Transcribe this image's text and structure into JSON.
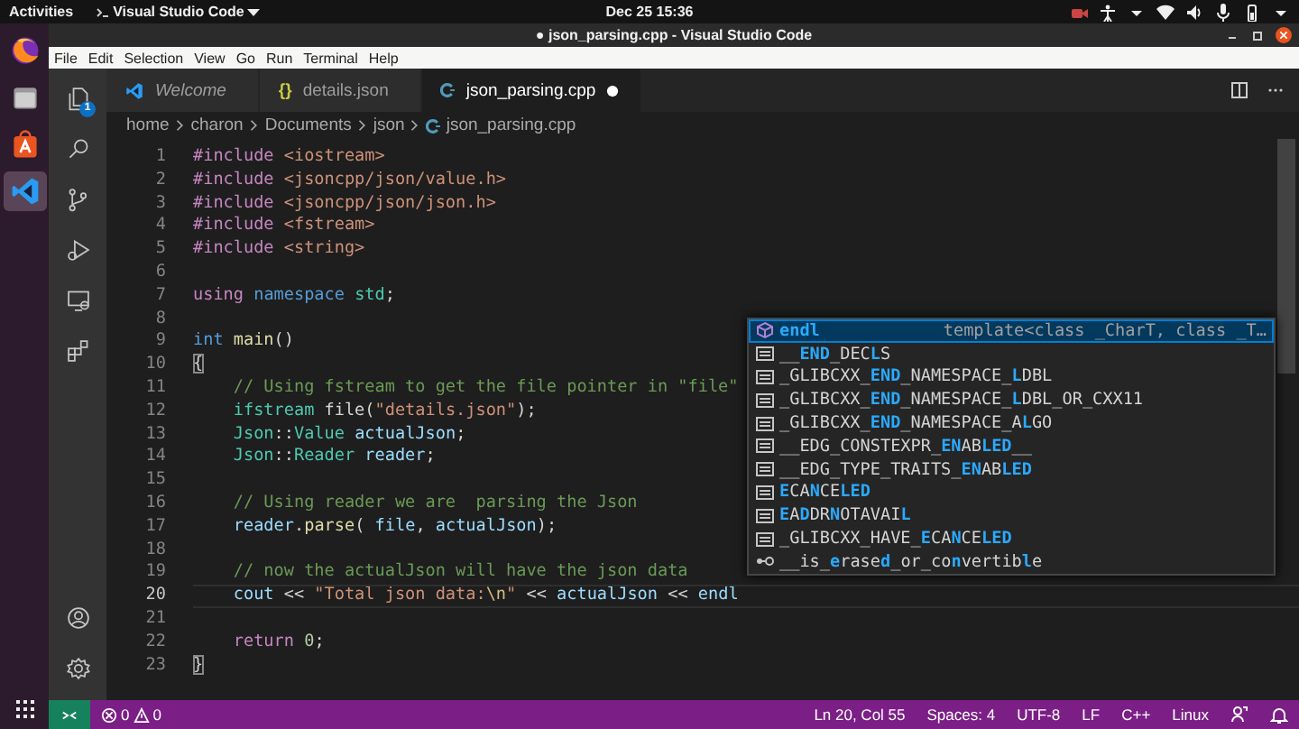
{
  "topbar": {
    "activities": "Activities",
    "app_menu": "Visual Studio Code",
    "datetime": "Dec 25  15:36"
  },
  "dock": {
    "items": [
      {
        "kind": "firefox",
        "selected": false
      },
      {
        "kind": "files",
        "selected": false
      },
      {
        "kind": "software",
        "selected": false
      },
      {
        "kind": "vscode",
        "selected": true
      }
    ]
  },
  "window": {
    "title": "● json_parsing.cpp - Visual Studio Code"
  },
  "menu": [
    "File",
    "Edit",
    "Selection",
    "View",
    "Go",
    "Run",
    "Terminal",
    "Help"
  ],
  "activity_bar": {
    "top": [
      {
        "kind": "explorer",
        "badge": "1"
      },
      {
        "kind": "search"
      },
      {
        "kind": "source-control"
      },
      {
        "kind": "run"
      },
      {
        "kind": "remote"
      },
      {
        "kind": "extensions"
      }
    ],
    "bottom": [
      {
        "kind": "account"
      },
      {
        "kind": "settings"
      }
    ]
  },
  "tabs": [
    {
      "kind": "welcome",
      "label": "Welcome",
      "preview": true,
      "selected": false,
      "modified": false
    },
    {
      "kind": "json",
      "icon": "{}",
      "label": "details.json",
      "preview": false,
      "selected": false,
      "modified": false
    },
    {
      "kind": "cpp",
      "label": "json_parsing.cpp",
      "preview": false,
      "selected": true,
      "modified": true
    }
  ],
  "breadcrumb": [
    {
      "kind": "folder",
      "label": "home"
    },
    {
      "kind": "folder",
      "label": "charon"
    },
    {
      "kind": "folder",
      "label": "Documents"
    },
    {
      "kind": "folder",
      "label": "json"
    },
    {
      "kind": "cpp",
      "label": "json_parsing.cpp"
    }
  ],
  "editor": {
    "lines": [
      {
        "number": "1",
        "current": false,
        "tokens": [
          {
            "kind": "pre",
            "text": "#include "
          },
          {
            "kind": "inc",
            "text": "<iostream>"
          }
        ]
      },
      {
        "number": "2",
        "current": false,
        "tokens": [
          {
            "kind": "pre",
            "text": "#include "
          },
          {
            "kind": "inc",
            "text": "<jsoncpp/json/value.h>"
          }
        ]
      },
      {
        "number": "3",
        "current": false,
        "tokens": [
          {
            "kind": "pre",
            "text": "#include "
          },
          {
            "kind": "inc",
            "text": "<jsoncpp/json/json.h>"
          }
        ]
      },
      {
        "number": "4",
        "current": false,
        "tokens": [
          {
            "kind": "pre",
            "text": "#include "
          },
          {
            "kind": "inc",
            "text": "<fstream>"
          }
        ]
      },
      {
        "number": "5",
        "current": false,
        "tokens": [
          {
            "kind": "pre",
            "text": "#include "
          },
          {
            "kind": "inc",
            "text": "<string>"
          }
        ]
      },
      {
        "number": "6",
        "current": false
      },
      {
        "number": "7",
        "current": false,
        "tokens": [
          {
            "kind": "ctl",
            "text": "using "
          },
          {
            "kind": "kw",
            "text": "namespace "
          },
          {
            "kind": "type",
            "text": "std"
          },
          {
            "kind": "plain",
            "text": ";"
          }
        ]
      },
      {
        "number": "8",
        "current": false
      },
      {
        "number": "9",
        "current": false,
        "tokens": [
          {
            "kind": "kw",
            "text": "int "
          },
          {
            "kind": "fn",
            "text": "main"
          },
          {
            "kind": "plain",
            "text": "()"
          }
        ]
      },
      {
        "number": "10",
        "current": false,
        "tokens": [
          {
            "kind": "bracket-match",
            "text": "{"
          }
        ]
      },
      {
        "number": "11",
        "current": false,
        "tokens": [
          {
            "kind": "com",
            "text": "    // Using fstream to get the file pointer in \"file\""
          }
        ]
      },
      {
        "number": "12",
        "current": false,
        "tokens": [
          {
            "kind": "type",
            "text": "    ifstream"
          },
          {
            "kind": "plain",
            "text": " file("
          },
          {
            "kind": "str",
            "text": "\"details.json\""
          },
          {
            "kind": "plain",
            "text": ");"
          }
        ]
      },
      {
        "number": "13",
        "current": false,
        "tokens": [
          {
            "kind": "type",
            "text": "    Json"
          },
          {
            "kind": "plain",
            "text": "::"
          },
          {
            "kind": "type",
            "text": "Value "
          },
          {
            "kind": "var",
            "text": "actualJson"
          },
          {
            "kind": "plain",
            "text": ";"
          }
        ]
      },
      {
        "number": "14",
        "current": false,
        "tokens": [
          {
            "kind": "type",
            "text": "    Json"
          },
          {
            "kind": "plain",
            "text": "::"
          },
          {
            "kind": "type",
            "text": "Reader "
          },
          {
            "kind": "var",
            "text": "reader"
          },
          {
            "kind": "plain",
            "text": ";"
          }
        ]
      },
      {
        "number": "15",
        "current": false
      },
      {
        "number": "16",
        "current": false,
        "tokens": [
          {
            "kind": "com",
            "text": "    // Using reader we are  parsing the Json"
          }
        ]
      },
      {
        "number": "17",
        "current": false,
        "tokens": [
          {
            "kind": "var",
            "text": "    reader"
          },
          {
            "kind": "plain",
            "text": "."
          },
          {
            "kind": "fn",
            "text": "parse"
          },
          {
            "kind": "plain",
            "text": "( "
          },
          {
            "kind": "var",
            "text": "file"
          },
          {
            "kind": "plain",
            "text": ", "
          },
          {
            "kind": "var",
            "text": "actualJson"
          },
          {
            "kind": "plain",
            "text": ");"
          }
        ]
      },
      {
        "number": "18",
        "current": false
      },
      {
        "number": "19",
        "current": false,
        "tokens": [
          {
            "kind": "com",
            "text": "    // now the actualJson will have the json data"
          }
        ]
      },
      {
        "number": "20",
        "current": true,
        "tokens": [
          {
            "kind": "var",
            "text": "    cout"
          },
          {
            "kind": "plain",
            "text": " << "
          },
          {
            "kind": "str",
            "text": "\"Total json data:"
          },
          {
            "kind": "esc",
            "text": "\\n"
          },
          {
            "kind": "str",
            "text": "\""
          },
          {
            "kind": "plain",
            "text": " << "
          },
          {
            "kind": "var",
            "text": "actualJson"
          },
          {
            "kind": "plain",
            "text": " << "
          },
          {
            "kind": "var",
            "text": "endl"
          }
        ]
      },
      {
        "number": "21",
        "current": false
      },
      {
        "number": "22",
        "current": false,
        "tokens": [
          {
            "kind": "ctl",
            "text": "    return "
          },
          {
            "kind": "num",
            "text": "0"
          },
          {
            "kind": "plain",
            "text": ";"
          }
        ]
      },
      {
        "number": "23",
        "current": false,
        "tokens": [
          {
            "kind": "bracket-match",
            "text": "}"
          }
        ]
      }
    ]
  },
  "completion": {
    "items": [
      {
        "kind": "method",
        "selected": true,
        "parts": [
          {
            "text": "endl",
            "match": true
          }
        ],
        "detail": "template<class _CharT, class _T…"
      },
      {
        "kind": "text",
        "selected": false,
        "parts": [
          {
            "text": "__",
            "match": false
          },
          {
            "text": "END",
            "match": true
          },
          {
            "text": "_DEC",
            "match": false
          },
          {
            "text": "L",
            "match": true
          },
          {
            "text": "S",
            "match": false
          }
        ]
      },
      {
        "kind": "text",
        "selected": false,
        "parts": [
          {
            "text": "_GLIBCXX_",
            "match": false
          },
          {
            "text": "END",
            "match": true
          },
          {
            "text": "_NAMESPACE_",
            "match": false
          },
          {
            "text": "L",
            "match": true
          },
          {
            "text": "DBL",
            "match": false
          }
        ]
      },
      {
        "kind": "text",
        "selected": false,
        "parts": [
          {
            "text": "_GLIBCXX_",
            "match": false
          },
          {
            "text": "END",
            "match": true
          },
          {
            "text": "_NAMESPACE_",
            "match": false
          },
          {
            "text": "L",
            "match": true
          },
          {
            "text": "DBL_OR_CXX11",
            "match": false
          }
        ]
      },
      {
        "kind": "text",
        "selected": false,
        "parts": [
          {
            "text": "_GLIBCXX_",
            "match": false
          },
          {
            "text": "END",
            "match": true
          },
          {
            "text": "_NAMESPACE_A",
            "match": false
          },
          {
            "text": "L",
            "match": true
          },
          {
            "text": "GO",
            "match": false
          }
        ]
      },
      {
        "kind": "text",
        "selected": false,
        "parts": [
          {
            "text": "__EDG_CONSTEXPR_",
            "match": false
          },
          {
            "text": "EN",
            "match": true
          },
          {
            "text": "AB",
            "match": false
          },
          {
            "text": "LED",
            "match": true
          },
          {
            "text": "__",
            "match": false
          }
        ]
      },
      {
        "kind": "text",
        "selected": false,
        "parts": [
          {
            "text": "__EDG_TYPE_TRAITS_",
            "match": false
          },
          {
            "text": "EN",
            "match": true
          },
          {
            "text": "AB",
            "match": false
          },
          {
            "text": "LED",
            "match": true
          }
        ]
      },
      {
        "kind": "text",
        "selected": false,
        "parts": [
          {
            "text": "E",
            "match": true
          },
          {
            "text": "CA",
            "match": false
          },
          {
            "text": "N",
            "match": true
          },
          {
            "text": "CE",
            "match": false
          },
          {
            "text": "LED",
            "match": true
          }
        ]
      },
      {
        "kind": "text",
        "selected": false,
        "parts": [
          {
            "text": "E",
            "match": true
          },
          {
            "text": "A",
            "match": false
          },
          {
            "text": "D",
            "match": true
          },
          {
            "text": "DR",
            "match": false
          },
          {
            "text": "N",
            "match": true
          },
          {
            "text": "OTAVAI",
            "match": false
          },
          {
            "text": "L",
            "match": true
          }
        ]
      },
      {
        "kind": "text",
        "selected": false,
        "parts": [
          {
            "text": "_GLIBCXX_HAVE_",
            "match": false
          },
          {
            "text": "E",
            "match": true
          },
          {
            "text": "CA",
            "match": false
          },
          {
            "text": "N",
            "match": true
          },
          {
            "text": "CE",
            "match": false
          },
          {
            "text": "LED",
            "match": true
          }
        ]
      },
      {
        "kind": "interface",
        "selected": false,
        "parts": [
          {
            "text": "__is_",
            "match": false
          },
          {
            "text": "e",
            "match": true
          },
          {
            "text": "rase",
            "match": false
          },
          {
            "text": "d",
            "match": true
          },
          {
            "text": "_or_co",
            "match": false
          },
          {
            "text": "n",
            "match": true
          },
          {
            "text": "vertib",
            "match": false
          },
          {
            "text": "l",
            "match": true
          },
          {
            "text": "e",
            "match": false
          }
        ]
      }
    ]
  },
  "status_bar": {
    "errors": "0",
    "warnings": "0",
    "items": [
      {
        "kind": "text",
        "label": "Ln 20, Col 55"
      },
      {
        "kind": "text",
        "label": "Spaces: 4"
      },
      {
        "kind": "text",
        "label": "UTF-8"
      },
      {
        "kind": "text",
        "label": "LF"
      },
      {
        "kind": "text",
        "label": "C++"
      },
      {
        "kind": "text",
        "label": "Linux"
      },
      {
        "kind": "feedback"
      },
      {
        "kind": "bell"
      }
    ]
  }
}
